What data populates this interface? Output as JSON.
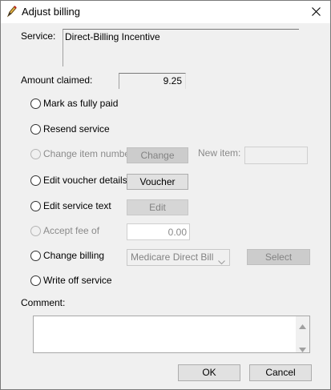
{
  "window": {
    "title": "Adjust billing"
  },
  "service": {
    "label": "Service:",
    "value": "Direct-Billing Incentive"
  },
  "amount": {
    "label": "Amount claimed:",
    "value": "9.25"
  },
  "options": [
    {
      "label": "Mark as fully paid",
      "enabled": true
    },
    {
      "label": "Resend service",
      "enabled": true
    },
    {
      "label": "Change item number",
      "enabled": false
    },
    {
      "label": "Edit voucher details",
      "enabled": true
    },
    {
      "label": "Edit service text",
      "enabled": true
    },
    {
      "label": "Accept fee of",
      "enabled": false
    },
    {
      "label": "Change billing",
      "enabled": true
    },
    {
      "label": "Write off service",
      "enabled": true
    }
  ],
  "change_item": {
    "button": "Change",
    "new_item_label": "New item:",
    "new_item_value": ""
  },
  "voucher": {
    "button": "Voucher"
  },
  "edit_text": {
    "button": "Edit"
  },
  "fee": {
    "value": "0.00"
  },
  "billing": {
    "selected": "Medicare Direct Bill",
    "select_button": "Select"
  },
  "comment": {
    "label": "Comment:",
    "value": ""
  },
  "footer": {
    "ok": "OK",
    "cancel": "Cancel"
  }
}
